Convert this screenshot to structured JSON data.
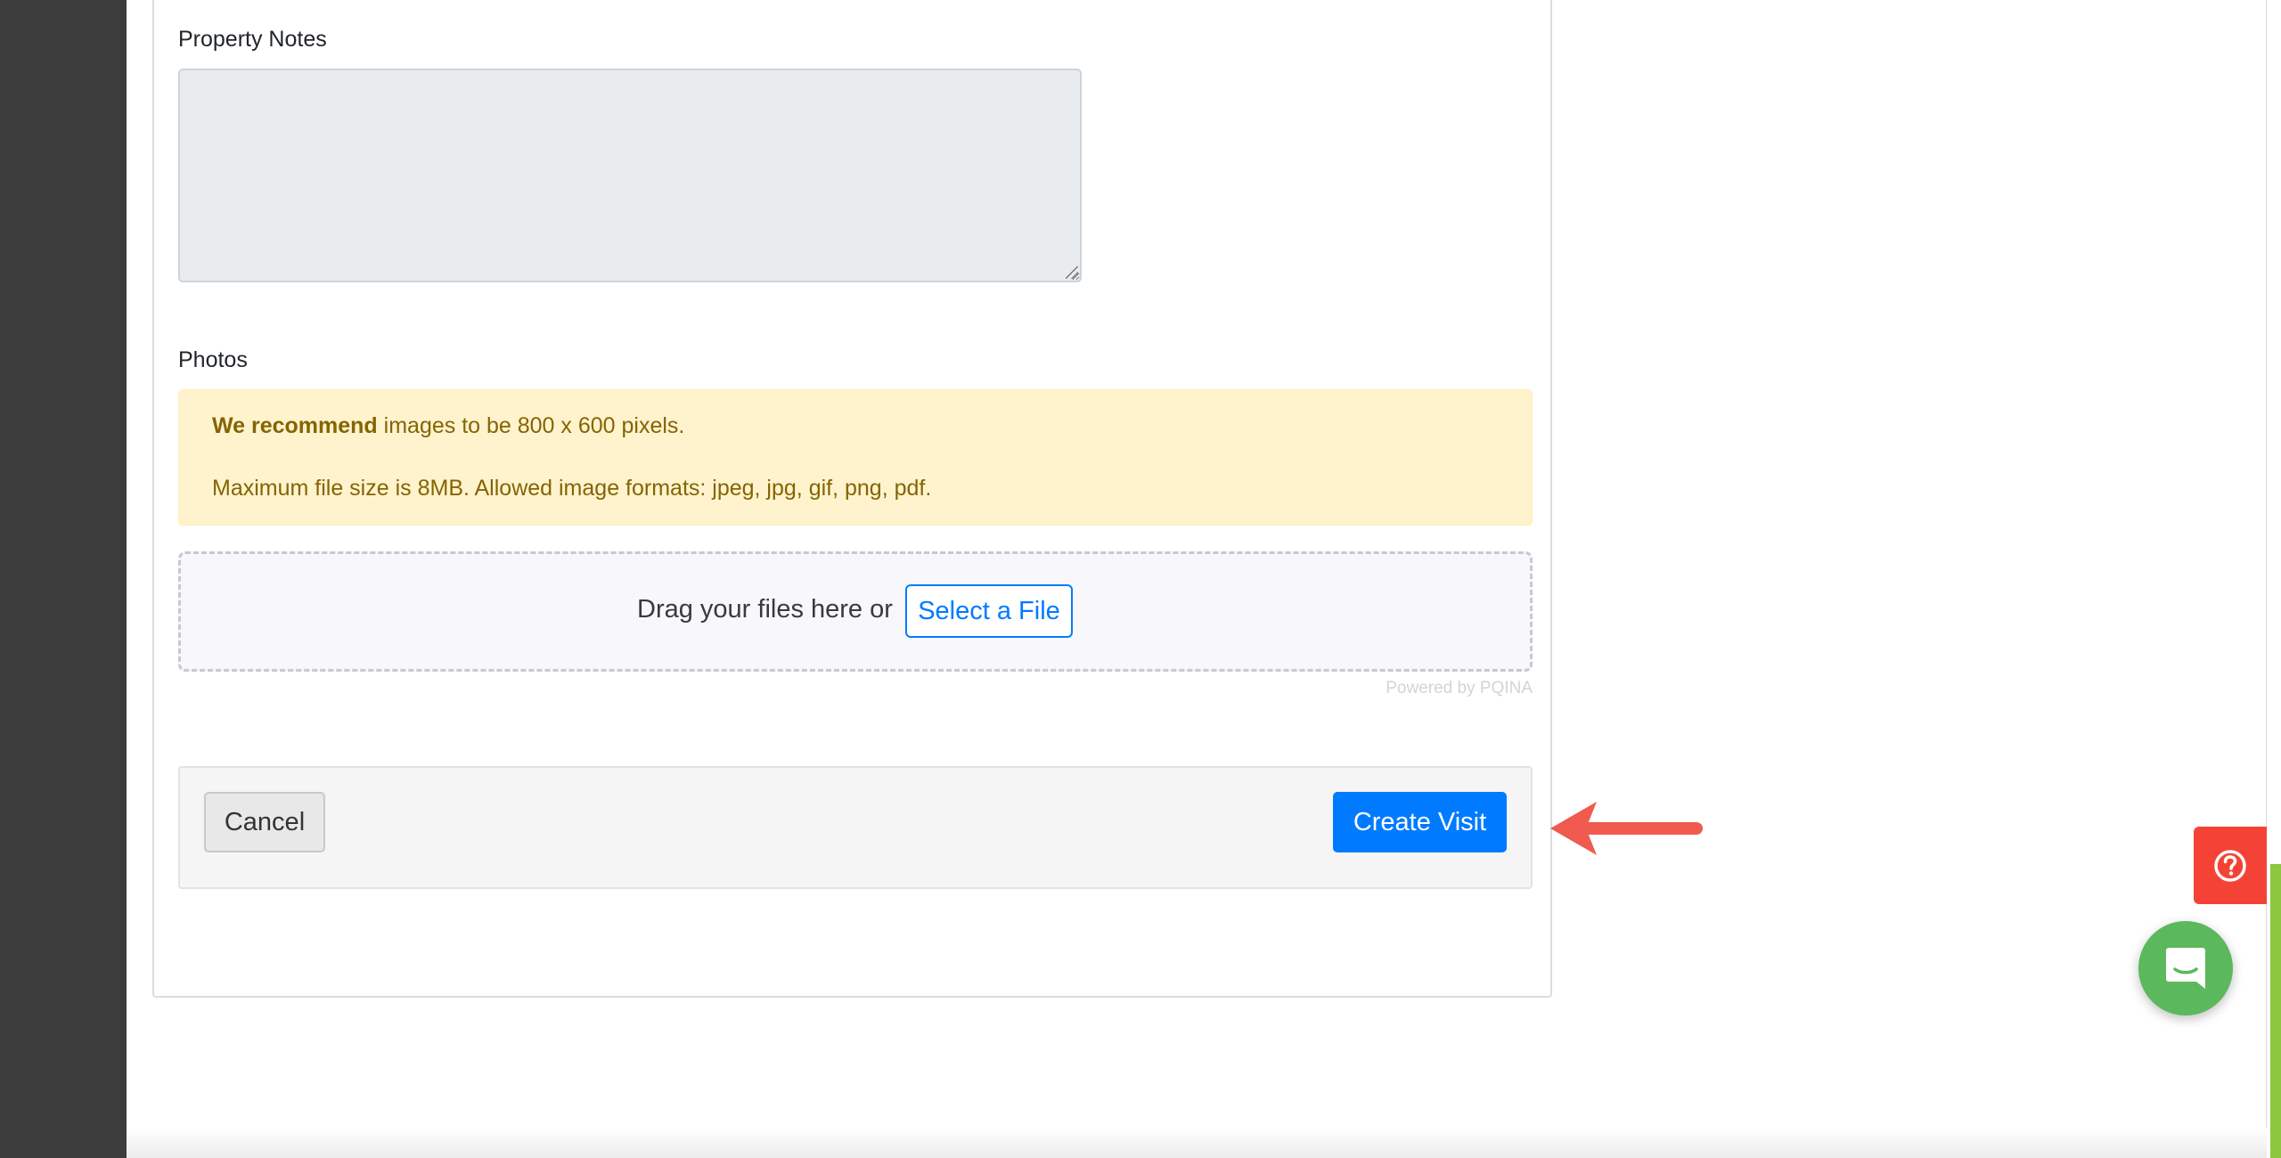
{
  "form": {
    "property_notes_label": "Property Notes",
    "property_notes_value": "",
    "photos_label": "Photos"
  },
  "alert": {
    "recommend_bold": "We recommend",
    "recommend_rest": " images to be 800 x 600 pixels.",
    "file_info": "Maximum file size is 8MB. Allowed image formats: jpeg, jpg, gif, png, pdf."
  },
  "dropzone": {
    "drag_text": "Drag your files here or",
    "select_label": "Select a File",
    "powered_by": "Powered by PQINA"
  },
  "footer": {
    "cancel_label": "Cancel",
    "create_label": "Create Visit"
  },
  "widgets": {
    "help_icon": "question-circle-icon",
    "chat_icon": "chat-bubble-icon"
  },
  "colors": {
    "primary": "#007bff",
    "alert_bg": "#fff3cd",
    "alert_text": "#856404",
    "help": "#f44336",
    "chat": "#5cb85c",
    "annotation_arrow": "#f05a4f"
  }
}
